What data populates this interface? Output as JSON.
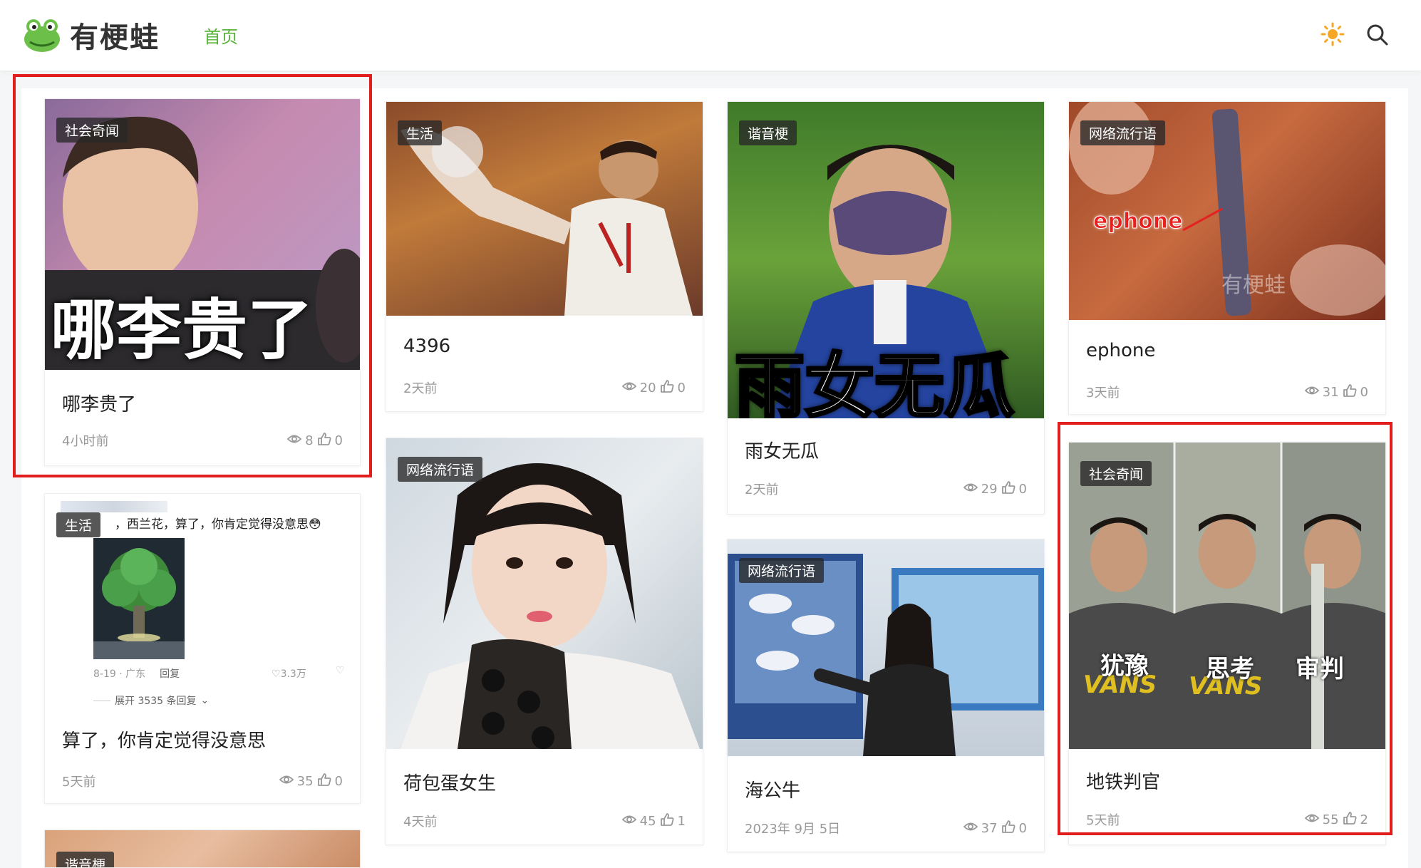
{
  "header": {
    "logo_text": "有梗蛙",
    "nav_home": "首页"
  },
  "icons": {
    "theme": "sun-icon",
    "search": "search-icon",
    "views": "eye-icon",
    "likes": "thumbs-up-icon"
  },
  "colors": {
    "accent": "#56b338",
    "sun": "#f5a623",
    "highlight": "#e21d1d"
  },
  "cards": [
    {
      "tag": "社会奇闻",
      "overlay": "哪李贵了",
      "title": "哪李贵了",
      "time": "4小时前",
      "views": "8",
      "likes": "0"
    },
    {
      "tag": "生活",
      "overlay": "",
      "title": "4396",
      "time": "2天前",
      "views": "20",
      "likes": "0"
    },
    {
      "tag": "谐音梗",
      "overlay": "雨女无瓜",
      "title": "雨女无瓜",
      "time": "2天前",
      "views": "29",
      "likes": "0"
    },
    {
      "tag": "网络流行语",
      "overlay": "ephone",
      "watermark": "有梗蛙",
      "title": "ephone",
      "time": "3天前",
      "views": "31",
      "likes": "0"
    },
    {
      "tag": "生活",
      "comment_text": "，西兰花，算了，你肯定觉得没意思😳",
      "comment_meta": "8-19 · 广东",
      "comment_reply": "回复",
      "comment_likes": "3.3万",
      "comment_expand": "展开 3535 条回复",
      "title": "算了，你肯定觉得没意思",
      "time": "5天前",
      "views": "35",
      "likes": "0"
    },
    {
      "tag": "网络流行语",
      "overlay": "",
      "title": "荷包蛋女生",
      "time": "4天前",
      "views": "45",
      "likes": "1"
    },
    {
      "tag": "网络流行语",
      "overlay": "",
      "title": "海公牛",
      "time": "2023年 9月 5日",
      "views": "37",
      "likes": "0"
    },
    {
      "tag": "社会奇闻",
      "overlay_words": [
        "犹豫",
        "思考",
        "审判"
      ],
      "shirt_text": "VANS",
      "title": "地铁判官",
      "time": "5天前",
      "views": "55",
      "likes": "2"
    },
    {
      "tag": "谐音梗"
    }
  ]
}
